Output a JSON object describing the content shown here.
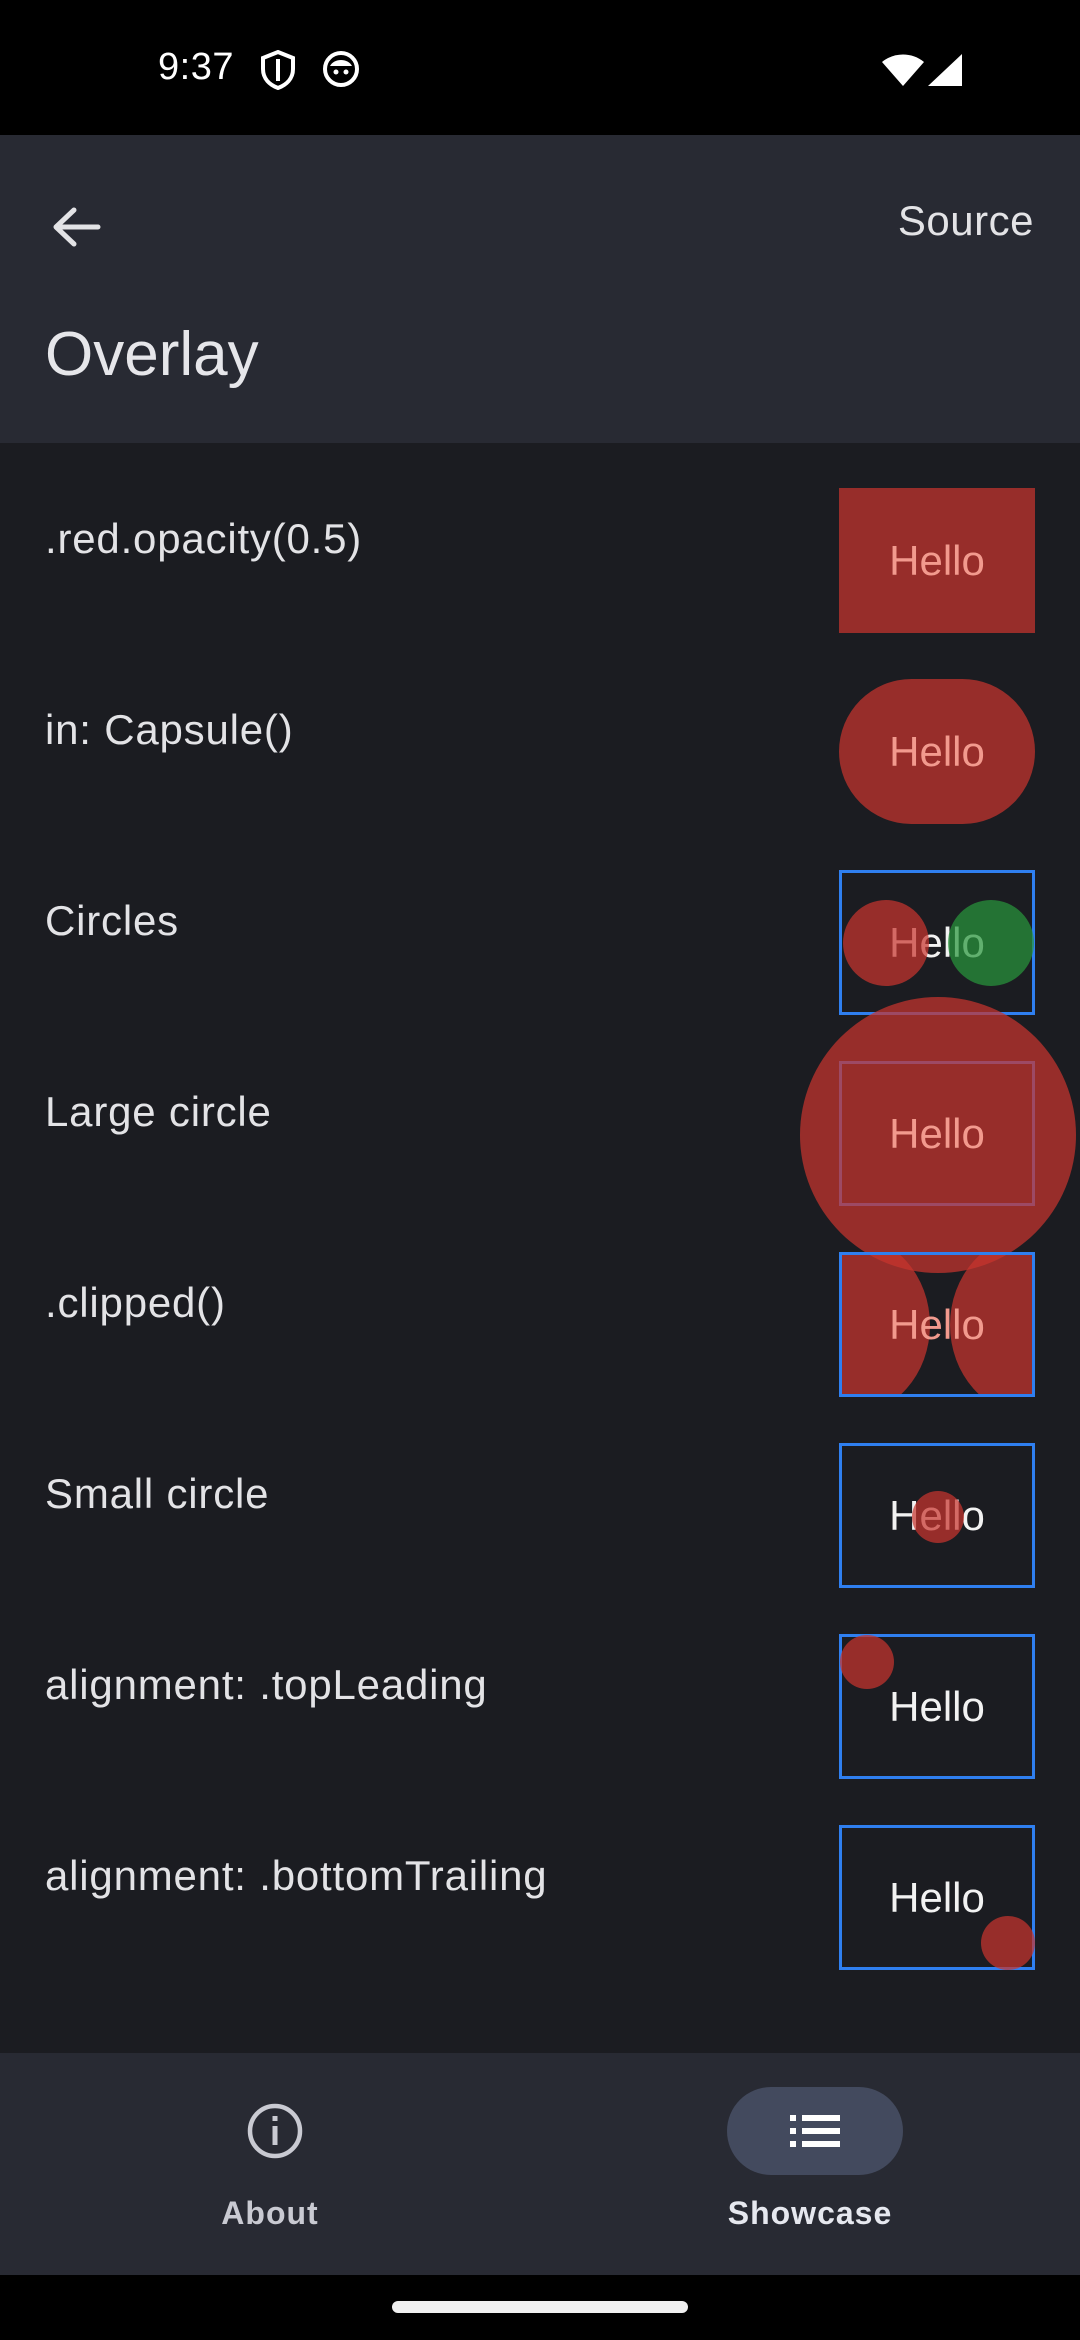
{
  "status_bar": {
    "time": "9:37",
    "icons": [
      "shield-icon",
      "cat-face-icon",
      "wifi-icon",
      "cell-signal-icon"
    ]
  },
  "app_bar": {
    "back_icon": "arrow-left-icon",
    "source_label": "Source",
    "title": "Overlay"
  },
  "rows": [
    {
      "label": ".red.opacity(0.5)",
      "demo_text": "Hello"
    },
    {
      "label": "in: Capsule()",
      "demo_text": "Hello"
    },
    {
      "label": "Circles",
      "demo_text": "Hello"
    },
    {
      "label": "Large circle",
      "demo_text": "Hello"
    },
    {
      "label": ".clipped()",
      "demo_text": "Hello"
    },
    {
      "label": "Small circle",
      "demo_text": "Hello"
    },
    {
      "label": "alignment: .topLeading",
      "demo_text": "Hello"
    },
    {
      "label": "alignment: .bottomTrailing",
      "demo_text": "Hello"
    }
  ],
  "bottom_nav": {
    "items": [
      {
        "label": "About",
        "icon": "info-icon",
        "selected": false
      },
      {
        "label": "Showcase",
        "icon": "list-icon",
        "selected": true
      }
    ]
  },
  "colors": {
    "overlay_red": "#c8342e",
    "overlay_green": "#28963c",
    "border_blue": "#2f7ff0",
    "background": "#1b1c21",
    "app_bar": "#282a33"
  }
}
